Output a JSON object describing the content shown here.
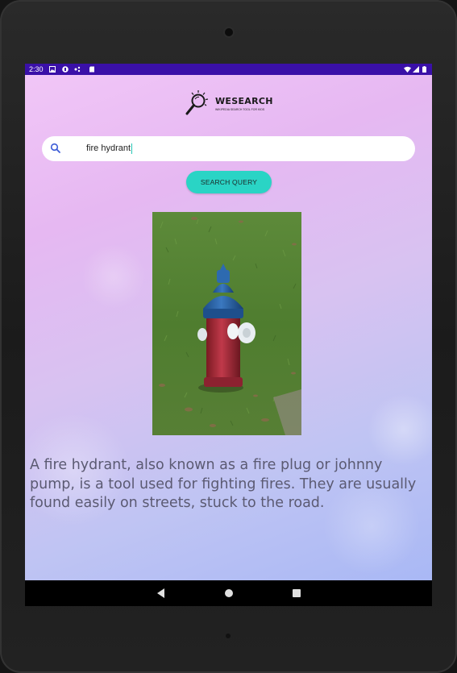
{
  "status_bar": {
    "time": "2:30",
    "left_icons": [
      "gallery-icon",
      "notification-icon",
      "cast-icon",
      "sd-card-icon"
    ],
    "right_icons": [
      "wifi-icon",
      "signal-icon",
      "battery-icon"
    ]
  },
  "app": {
    "logo_title": "WESEARCH",
    "logo_tagline": "WIKIPEDIA SEARCH TOOL FOR KIDS",
    "search": {
      "value": "fire hydrant",
      "icon": "search-icon"
    },
    "search_button_label": "SEARCH QUERY",
    "result_image": "fire-hydrant-photo",
    "result_text": "A fire hydrant, also known as a fire plug or johnny pump, is a tool used for fighting fires. They are usually found easily on streets, stuck to the road."
  },
  "nav_bar": {
    "buttons": [
      "back-button",
      "home-button",
      "recents-button"
    ]
  },
  "colors": {
    "status_bar": "#3a10a8",
    "accent": "#2ad4c5",
    "text": "#5b5a72"
  }
}
